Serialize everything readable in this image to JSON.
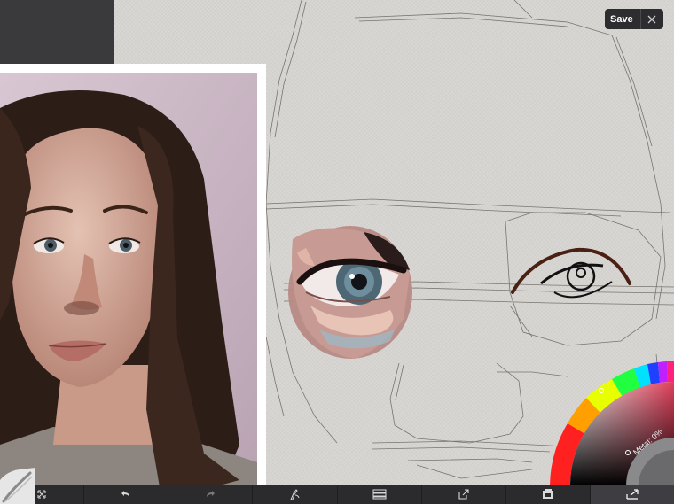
{
  "top_right": {
    "save_label": "Save",
    "close_icon": "close-icon"
  },
  "color_puck": {
    "metal_label": "Metal: 0%",
    "selected_hue": "#e0405a"
  },
  "toolbar": {
    "items": [
      {
        "icon": "transform-icon"
      },
      {
        "icon": "undo-icon"
      },
      {
        "icon": "redo-icon"
      },
      {
        "icon": "brush-icon"
      },
      {
        "icon": "layers-icon"
      },
      {
        "icon": "export-icon"
      },
      {
        "icon": "gallery-icon"
      },
      {
        "icon": "resize-icon"
      }
    ]
  },
  "colors": {
    "toolbar_bg": "#2b2b2d",
    "canvas_bg": "#d9d7d4",
    "ref_frame": "#ffffff"
  }
}
